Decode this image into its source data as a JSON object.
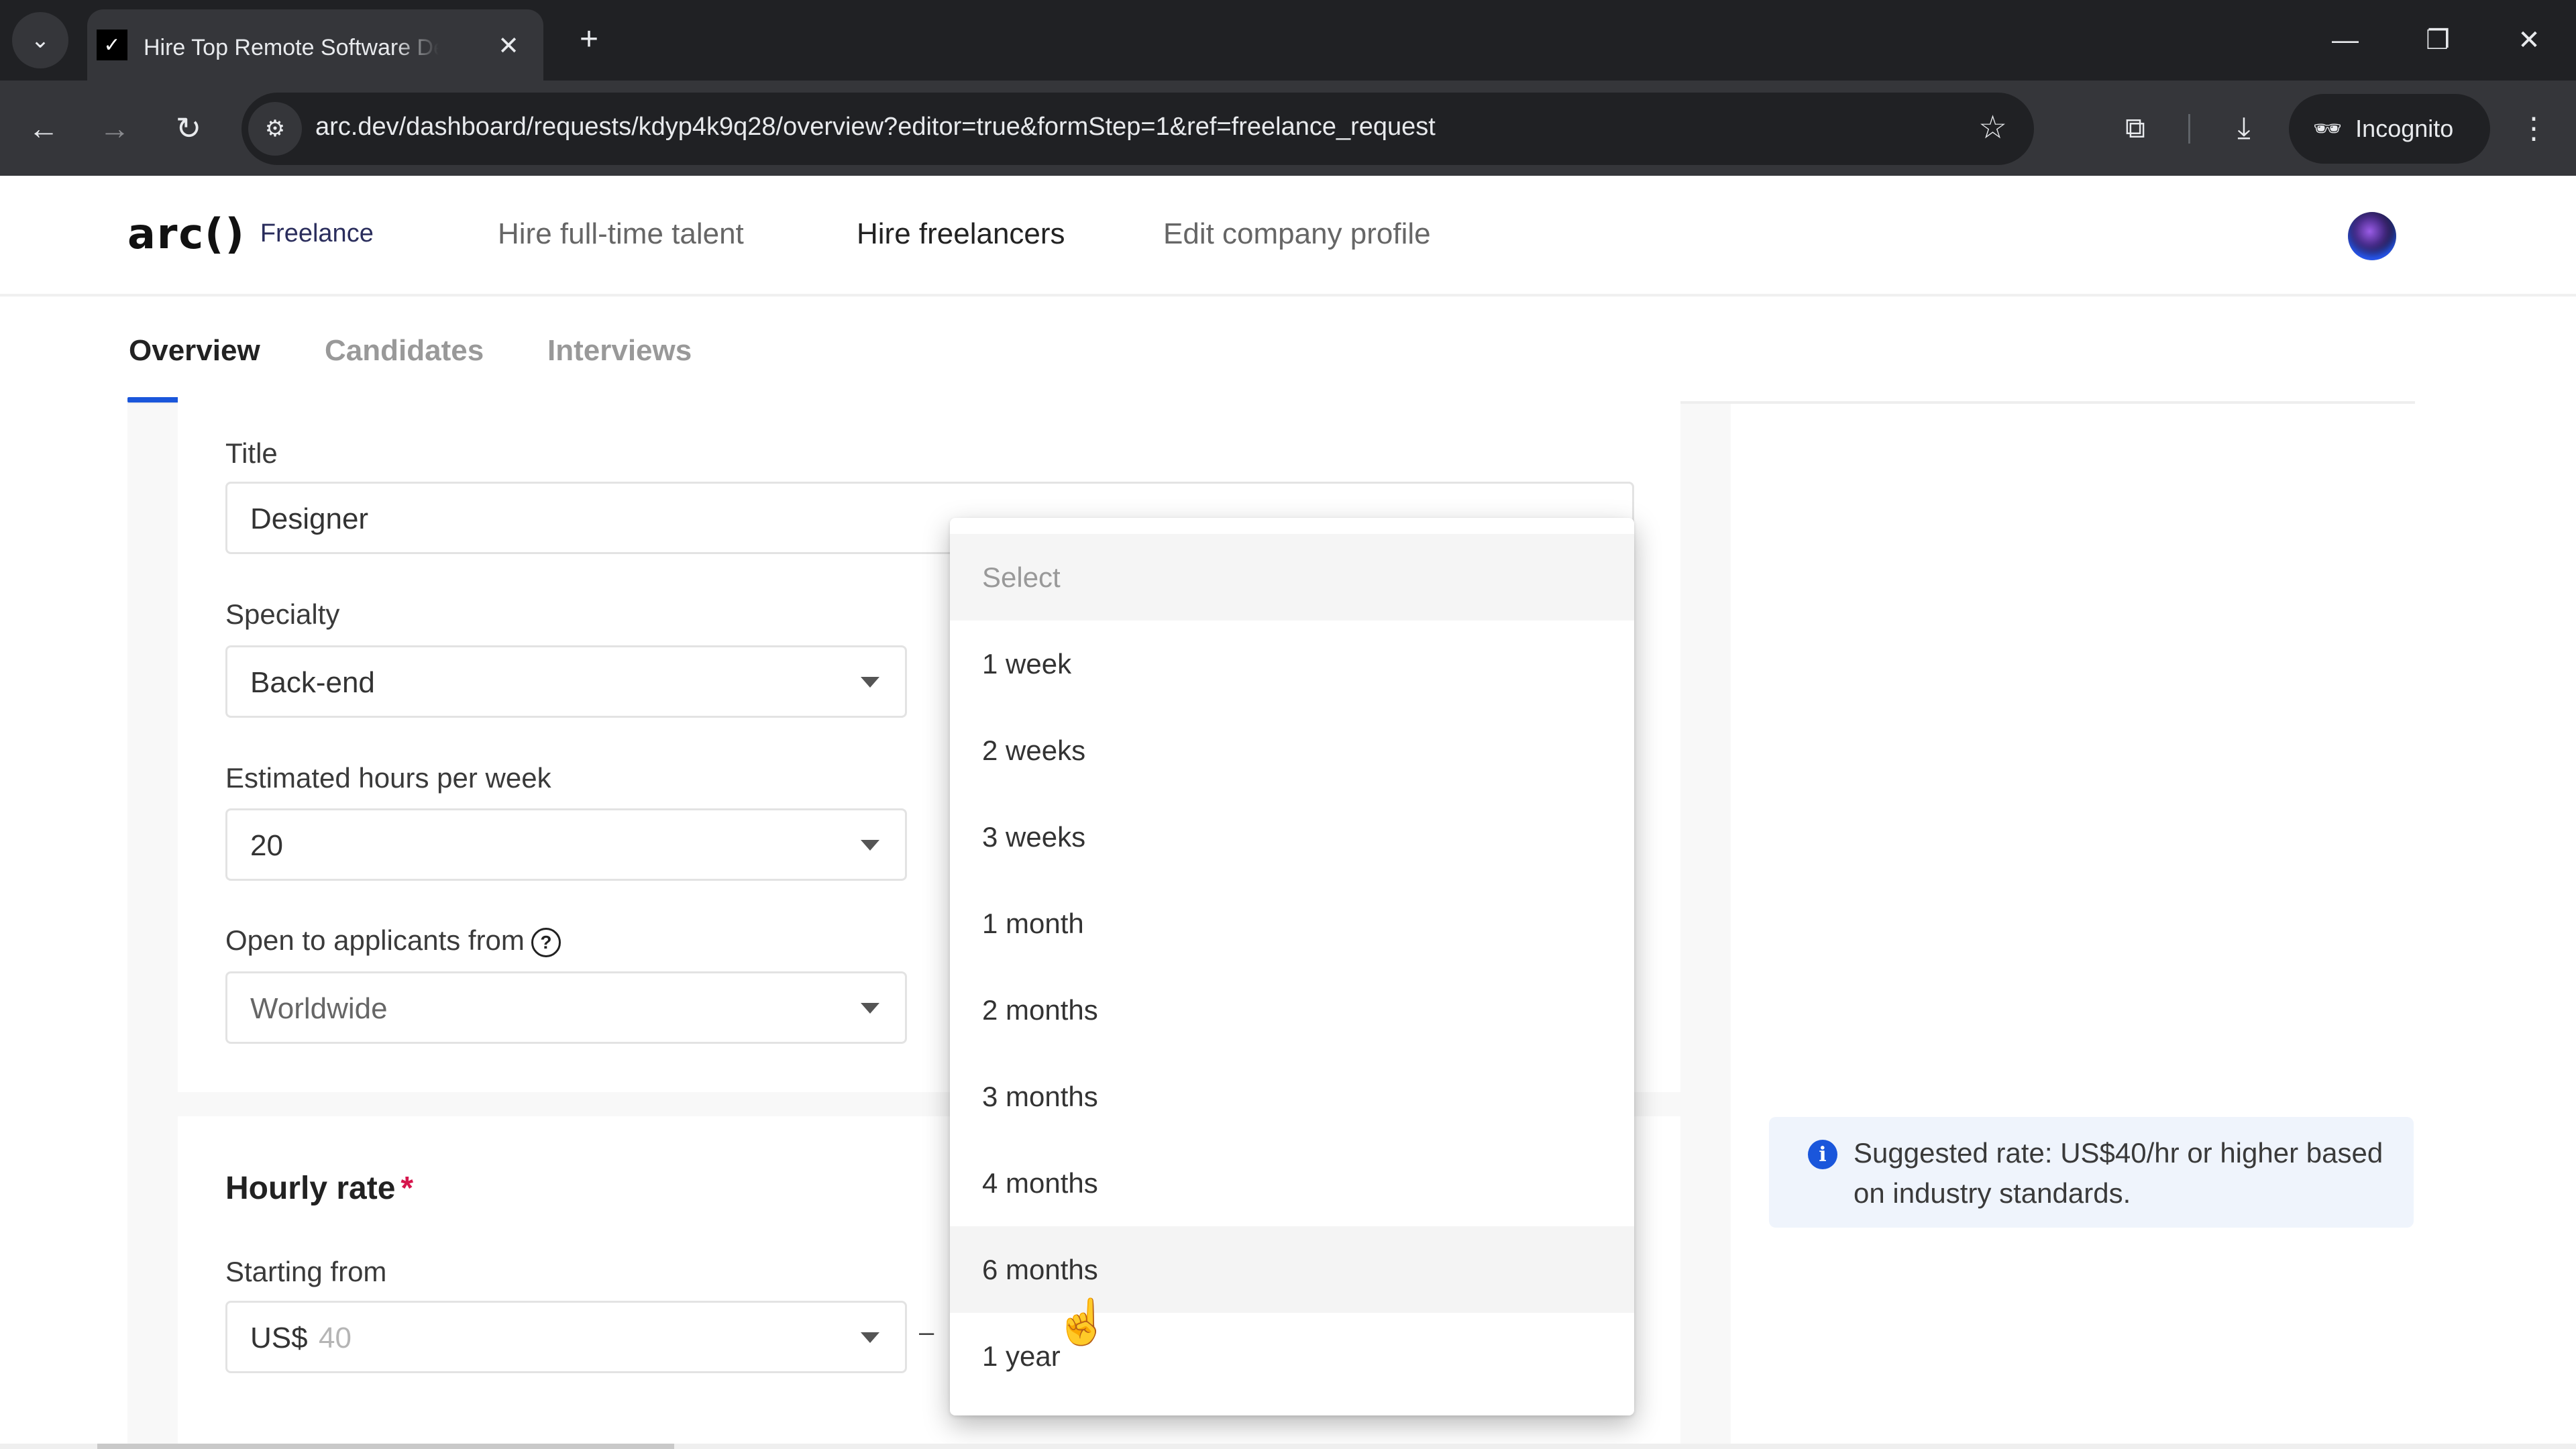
{
  "browser": {
    "tab_title": "Hire Top Remote Software Developers",
    "tab_close": "✕",
    "new_tab": "+",
    "tab_list": "⌄",
    "window_controls": {
      "minimize": "—",
      "restore": "❐",
      "close": "✕"
    },
    "nav": {
      "back": "←",
      "forward": "→",
      "reload": "↻"
    },
    "site_info_icon": "⚙",
    "url": "arc.dev/dashboard/requests/kdyp4k9q28/overview?editor=true&formStep=1&ref=freelance_request",
    "bookmark_icon": "☆",
    "extensions_icon": "⧉",
    "download_icon": "⤓",
    "incognito_icon": "🕶",
    "incognito_label": "Incognito",
    "menu_icon": "⋮"
  },
  "header": {
    "logo_mark": "arc()",
    "logo_sub": "Freelance",
    "nav": [
      {
        "label": "Hire full-time talent",
        "active": false
      },
      {
        "label": "Hire freelancers",
        "active": true
      },
      {
        "label": "Edit company profile",
        "active": false
      }
    ]
  },
  "tabs": [
    {
      "label": "Overview",
      "active": true
    },
    {
      "label": "Candidates",
      "active": false
    },
    {
      "label": "Interviews",
      "active": false
    }
  ],
  "form": {
    "title": {
      "label": "Title",
      "value": "Designer"
    },
    "specialty": {
      "label": "Specialty",
      "value": "Back-end"
    },
    "hours": {
      "label": "Estimated hours per week",
      "value": "20"
    },
    "applicants": {
      "label": "Open to applicants from",
      "help_icon": "?",
      "value": "Worldwide"
    },
    "hourly_rate": {
      "heading": "Hourly rate",
      "required_mark": "*",
      "starting_label": "Starting from",
      "currency": "US$",
      "placeholder": "40",
      "range_dash": "–"
    }
  },
  "duration_dropdown": {
    "placeholder": "Select",
    "options": [
      "1 week",
      "2 weeks",
      "3 weeks",
      "1 month",
      "2 months",
      "3 months",
      "4 months",
      "6 months",
      "1 year"
    ],
    "hovered": "6 months"
  },
  "info": {
    "icon": "i",
    "text": "Suggested rate: US$40/hr or higher based on industry standards."
  },
  "colors": {
    "accent": "#1a56db",
    "required": "#d6174d",
    "info_bg": "#eff4fc"
  }
}
